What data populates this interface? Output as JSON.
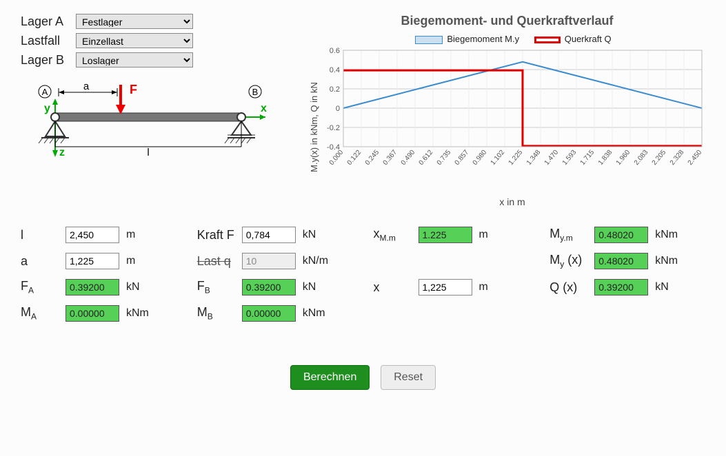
{
  "form": {
    "lagerA_label": "Lager A",
    "lagerA_value": "Festlager",
    "lastfall_label": "Lastfall",
    "lastfall_value": "Einzellast",
    "lagerB_label": "Lager B",
    "lagerB_value": "Loslager"
  },
  "beam": {
    "labelA": "A",
    "labelB": "B",
    "label_a": "a",
    "label_F": "F",
    "label_l": "l",
    "axis_y": "y",
    "axis_x": "x",
    "axis_z": "z"
  },
  "chart_data": {
    "type": "line",
    "title": "Biegemoment- und Querkraftverlauf",
    "ylabel": "M.y(x) in kNm, Q in kN",
    "xlabel": "x in m",
    "ylim": [
      -0.4,
      0.6
    ],
    "yticks": [
      -0.4,
      -0.2,
      0,
      0.2,
      0.4,
      0.6
    ],
    "xticks": [
      "0.000",
      "0.122",
      "0.245",
      "0.367",
      "0.490",
      "0.612",
      "0.735",
      "0.857",
      "0.980",
      "1.102",
      "1.225",
      "1.348",
      "1.470",
      "1.593",
      "1.715",
      "1.838",
      "1.960",
      "2.083",
      "2.205",
      "2.328",
      "2.450"
    ],
    "series": [
      {
        "name": "Biegemoment M.y",
        "color": "#3b8ccf",
        "points": [
          [
            0.0,
            0.0
          ],
          [
            0.612,
            0.24
          ],
          [
            1.225,
            0.48
          ],
          [
            1.838,
            0.24
          ],
          [
            2.45,
            0.0
          ]
        ]
      },
      {
        "name": "Querkraft Q",
        "color": "#e00000",
        "points": [
          [
            0.0,
            0.392
          ],
          [
            1.225,
            0.392
          ],
          [
            1.225,
            -0.392
          ],
          [
            2.45,
            -0.392
          ]
        ]
      }
    ]
  },
  "params": {
    "l": {
      "label": "l",
      "value": "2,450",
      "unit": "m"
    },
    "a": {
      "label": "a",
      "value": "1,225",
      "unit": "m"
    },
    "FA": {
      "label_html": "F<sub>A</sub>",
      "value": "0.39200",
      "unit": "kN"
    },
    "MA": {
      "label_html": "M<sub>A</sub>",
      "value": "0.00000",
      "unit": "kNm"
    },
    "kraftF": {
      "label": "Kraft F",
      "value": "0,784",
      "unit": "kN"
    },
    "lastq": {
      "label": "Last q",
      "value": "10",
      "unit": "kN/m"
    },
    "FB": {
      "label_html": "F<sub>B</sub>",
      "value": "0.39200",
      "unit": "kN"
    },
    "MB": {
      "label_html": "M<sub>B</sub>",
      "value": "0.00000",
      "unit": "kNm"
    },
    "xMm": {
      "label_html": "x<sub>M.m</sub>",
      "value": "1.225",
      "unit": "m"
    },
    "x": {
      "label": "x",
      "value": "1,225",
      "unit": "m"
    },
    "Mym": {
      "label_html": "M<sub>y.m</sub>",
      "value": "0.48020",
      "unit": "kNm"
    },
    "Myx": {
      "label_html": "M<sub>y</sub> (x)",
      "value": "0.48020",
      "unit": "kNm"
    },
    "Qx": {
      "label": "Q (x)",
      "value": "0.39200",
      "unit": "kN"
    }
  },
  "buttons": {
    "calc": "Berechnen",
    "reset": "Reset"
  }
}
